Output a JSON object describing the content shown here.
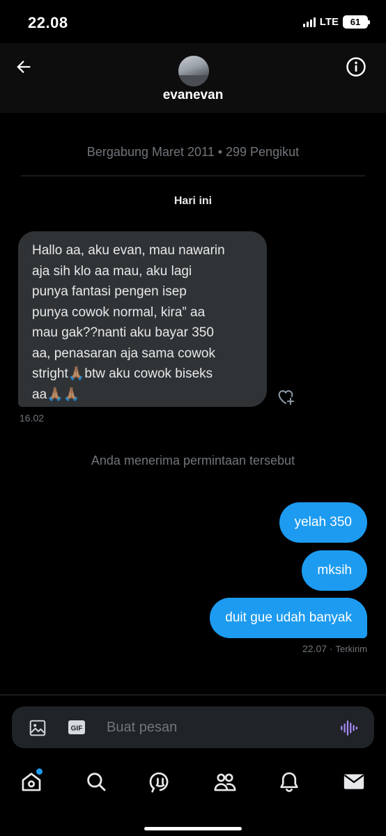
{
  "status_bar": {
    "time": "22.08",
    "network": "LTE",
    "battery": "61"
  },
  "header": {
    "username": "evanevan"
  },
  "conversation": {
    "joined_info": "Bergabung Maret 2011 • 299 Pengikut",
    "day_label": "Hari ini",
    "incoming_message": {
      "lines": [
        "Hallo aa, aku evan, mau nawarin",
        "aja sih klo aa mau, aku lagi",
        "punya fantasi pengen isep",
        "punya cowok normal, kira” aa",
        "mau gak??nanti aku bayar 350",
        "aa, penasaran aja sama cowok",
        "stright🙏🏽btw aku cowok biseks",
        "aa🙏🏽🙏🏽"
      ],
      "time": "16.02"
    },
    "system_notice": "Anda menerima permintaan tersebut",
    "outgoing_messages": [
      "yelah 350",
      "mksih",
      "duit gue udah banyak"
    ],
    "sent_time": "22.07",
    "sent_separator": "·",
    "sent_status": "Terkirim"
  },
  "composer": {
    "placeholder": "Buat pesan",
    "gif_label": "GIF"
  },
  "tabbar": {
    "items": [
      "home",
      "search",
      "grok",
      "communities",
      "notifications",
      "messages"
    ]
  },
  "colors": {
    "accent": "#1d9bf0",
    "incoming_bubble": "#2f3336",
    "voice_icon": "#a78bfa"
  },
  "icons": {
    "back": "arrow-left-icon",
    "info": "info-circle-icon",
    "react": "heart-plus-icon",
    "media": "image-icon",
    "gif": "gif-icon",
    "voice": "waveform-icon"
  }
}
